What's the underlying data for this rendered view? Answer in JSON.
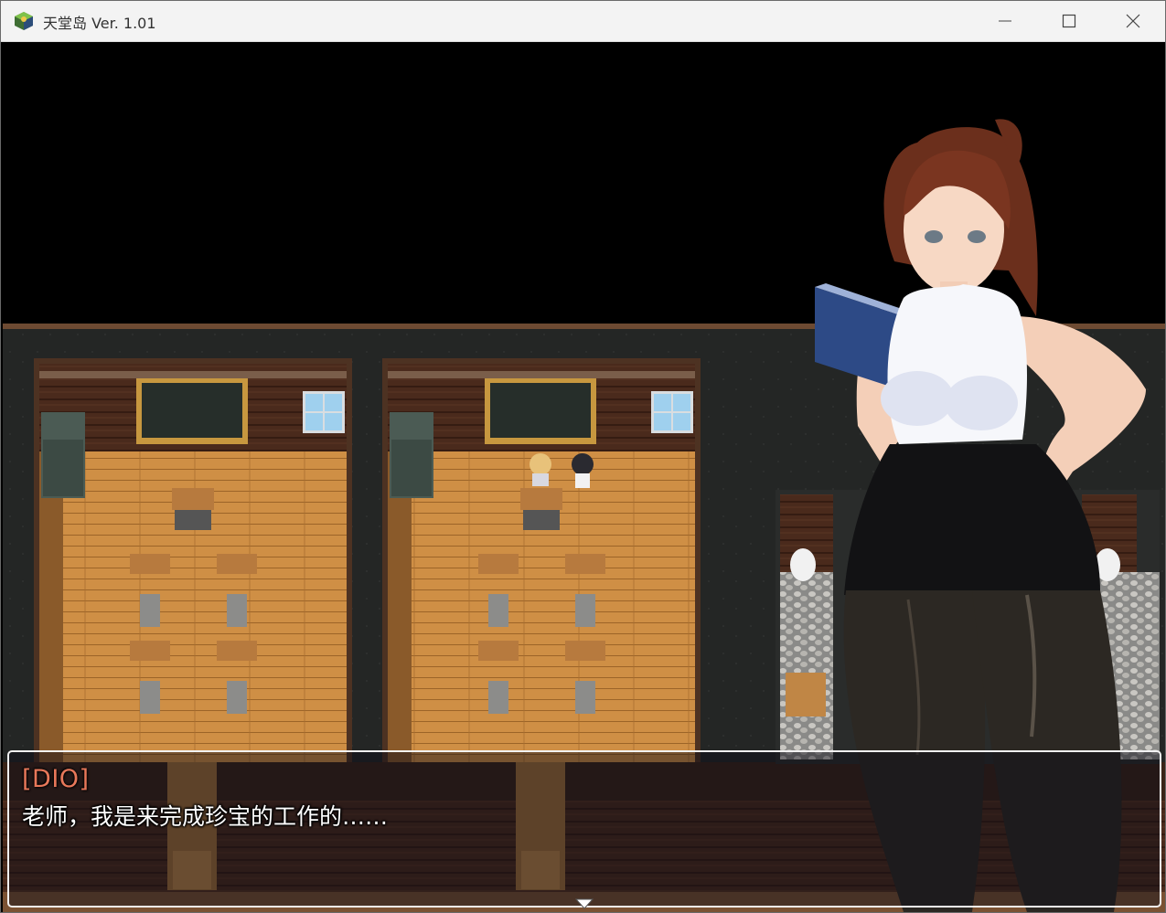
{
  "window": {
    "title": "天堂岛 Ver. 1.01",
    "icon": "app-game-icon",
    "controls": [
      "minimize-icon",
      "maximize-icon",
      "close-icon"
    ]
  },
  "scene": {
    "description_icon": "classroom-map",
    "characters": [
      "student-blonde",
      "student-dark-hair"
    ],
    "portrait": "teacher-portrait"
  },
  "dialog": {
    "speaker": "[DIO]",
    "message": "老师，我是来完成珍宝的工作的……",
    "continue_icon": "continue-arrow-icon"
  },
  "colors": {
    "speaker_color": "#e8785a",
    "text_color": "#ffffff",
    "floor_color": "#c98a3e",
    "wall_color": "#222425"
  }
}
